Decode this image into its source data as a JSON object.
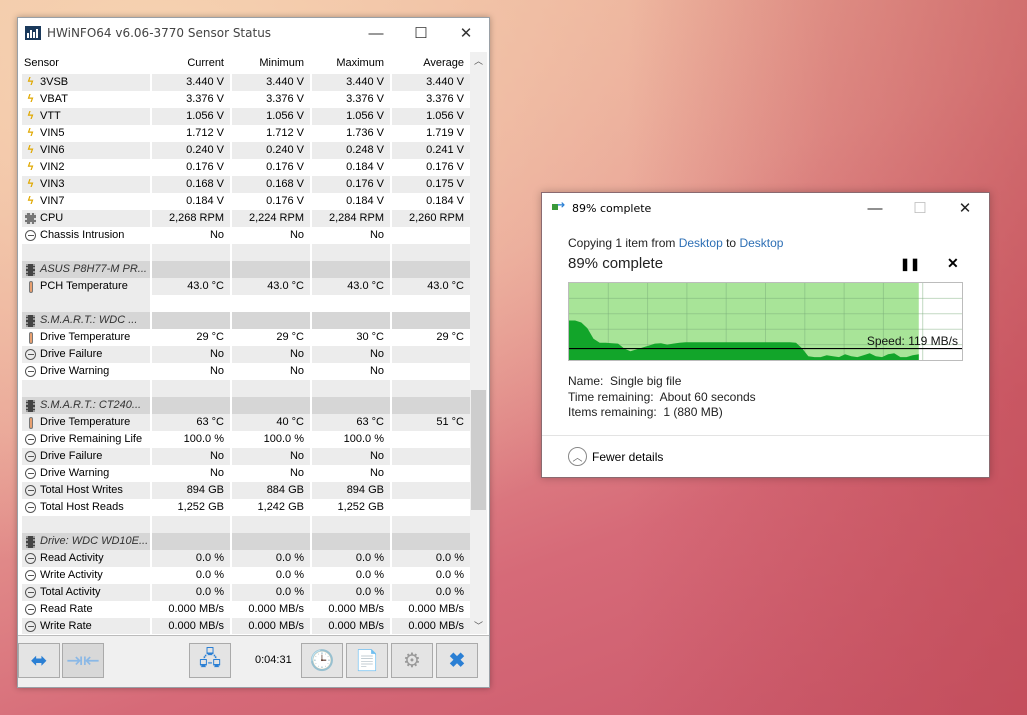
{
  "hwinfo": {
    "title": "HWiNFO64 v6.06-3770 Sensor Status",
    "columns": [
      "Sensor",
      "Current",
      "Minimum",
      "Maximum",
      "Average"
    ],
    "rows": [
      {
        "type": "data",
        "icon": "voltage",
        "name": "3VSB",
        "v": [
          "3.440 V",
          "3.440 V",
          "3.440 V",
          "3.440 V"
        ]
      },
      {
        "type": "data",
        "icon": "voltage",
        "name": "VBAT",
        "v": [
          "3.376 V",
          "3.376 V",
          "3.376 V",
          "3.376 V"
        ]
      },
      {
        "type": "data",
        "icon": "voltage",
        "name": "VTT",
        "v": [
          "1.056 V",
          "1.056 V",
          "1.056 V",
          "1.056 V"
        ]
      },
      {
        "type": "data",
        "icon": "voltage",
        "name": "VIN5",
        "v": [
          "1.712 V",
          "1.712 V",
          "1.736 V",
          "1.719 V"
        ]
      },
      {
        "type": "data",
        "icon": "voltage",
        "name": "VIN6",
        "v": [
          "0.240 V",
          "0.240 V",
          "0.248 V",
          "0.241 V"
        ]
      },
      {
        "type": "data",
        "icon": "voltage",
        "name": "VIN2",
        "v": [
          "0.176 V",
          "0.176 V",
          "0.184 V",
          "0.176 V"
        ]
      },
      {
        "type": "data",
        "icon": "voltage",
        "name": "VIN3",
        "v": [
          "0.168 V",
          "0.168 V",
          "0.176 V",
          "0.175 V"
        ]
      },
      {
        "type": "data",
        "icon": "voltage",
        "name": "VIN7",
        "v": [
          "0.184 V",
          "0.176 V",
          "0.184 V",
          "0.184 V"
        ]
      },
      {
        "type": "data",
        "icon": "fan",
        "name": "CPU",
        "v": [
          "2,268 RPM",
          "2,224 RPM",
          "2,284 RPM",
          "2,260 RPM"
        ]
      },
      {
        "type": "data",
        "icon": "clock",
        "name": "Chassis Intrusion",
        "v": [
          "No",
          "No",
          "No",
          ""
        ]
      },
      {
        "type": "blank"
      },
      {
        "type": "group",
        "icon": "chip",
        "name": "ASUS P8H77-M PR..."
      },
      {
        "type": "data",
        "icon": "thermometer",
        "name": "PCH Temperature",
        "v": [
          "43.0 °C",
          "43.0 °C",
          "43.0 °C",
          "43.0 °C"
        ]
      },
      {
        "type": "blank"
      },
      {
        "type": "group",
        "icon": "chip",
        "name": "S.M.A.R.T.: WDC ..."
      },
      {
        "type": "data",
        "icon": "thermometer",
        "name": "Drive Temperature",
        "v": [
          "29 °C",
          "29 °C",
          "30 °C",
          "29 °C"
        ]
      },
      {
        "type": "data",
        "icon": "clock",
        "name": "Drive Failure",
        "v": [
          "No",
          "No",
          "No",
          ""
        ]
      },
      {
        "type": "data",
        "icon": "clock",
        "name": "Drive Warning",
        "v": [
          "No",
          "No",
          "No",
          ""
        ]
      },
      {
        "type": "blank"
      },
      {
        "type": "group",
        "icon": "chip",
        "name": "S.M.A.R.T.: CT240..."
      },
      {
        "type": "data",
        "icon": "thermometer",
        "name": "Drive Temperature",
        "v": [
          "63 °C",
          "40 °C",
          "63 °C",
          "51 °C"
        ]
      },
      {
        "type": "data",
        "icon": "clock",
        "name": "Drive Remaining Life",
        "v": [
          "100.0 %",
          "100.0 %",
          "100.0 %",
          ""
        ]
      },
      {
        "type": "data",
        "icon": "clock",
        "name": "Drive Failure",
        "v": [
          "No",
          "No",
          "No",
          ""
        ]
      },
      {
        "type": "data",
        "icon": "clock",
        "name": "Drive Warning",
        "v": [
          "No",
          "No",
          "No",
          ""
        ]
      },
      {
        "type": "data",
        "icon": "clock",
        "name": "Total Host Writes",
        "v": [
          "894 GB",
          "884 GB",
          "894 GB",
          ""
        ]
      },
      {
        "type": "data",
        "icon": "clock",
        "name": "Total Host Reads",
        "v": [
          "1,252 GB",
          "1,242 GB",
          "1,252 GB",
          ""
        ]
      },
      {
        "type": "blank"
      },
      {
        "type": "group",
        "icon": "chip",
        "name": "Drive: WDC WD10E..."
      },
      {
        "type": "data",
        "icon": "clock",
        "name": "Read Activity",
        "v": [
          "0.0 %",
          "0.0 %",
          "0.0 %",
          "0.0 %"
        ]
      },
      {
        "type": "data",
        "icon": "clock",
        "name": "Write Activity",
        "v": [
          "0.0 %",
          "0.0 %",
          "0.0 %",
          "0.0 %"
        ]
      },
      {
        "type": "data",
        "icon": "clock",
        "name": "Total Activity",
        "v": [
          "0.0 %",
          "0.0 %",
          "0.0 %",
          "0.0 %"
        ]
      },
      {
        "type": "data",
        "icon": "clock",
        "name": "Read Rate",
        "v": [
          "0.000 MB/s",
          "0.000 MB/s",
          "0.000 MB/s",
          "0.000 MB/s"
        ]
      },
      {
        "type": "data",
        "icon": "clock",
        "name": "Write Rate",
        "v": [
          "0.000 MB/s",
          "0.000 MB/s",
          "0.000 MB/s",
          "0.000 MB/s"
        ]
      }
    ],
    "timer": "0:04:31"
  },
  "copy": {
    "title": "89% complete",
    "copying_prefix": "Copying 1 item from",
    "source": "Desktop",
    "to": "to",
    "dest": "Desktop",
    "progress_label": "89% complete",
    "progress_fraction": 0.89,
    "speed_label": "Speed: 119 MB/s",
    "current_speed": 119,
    "speed_max": 800,
    "speed_history": [
      410,
      410,
      390,
      330,
      220,
      180,
      180,
      175,
      170,
      120,
      90,
      110,
      130,
      150,
      170,
      175,
      160,
      170,
      180,
      185,
      185,
      185,
      185,
      185,
      185,
      185,
      185,
      185,
      185,
      185,
      185,
      185,
      185,
      185,
      185,
      185,
      185,
      180,
      120,
      40,
      30,
      30,
      50,
      40,
      30,
      60,
      40,
      30,
      50,
      70,
      40,
      30,
      60,
      70,
      30,
      30,
      50,
      60
    ],
    "name_label": "Name:",
    "name_value": "Single big file",
    "time_label": "Time remaining:",
    "time_value": "About 60 seconds",
    "items_label": "Items remaining:",
    "items_value": "1 (880 MB)",
    "fewer_details": "Fewer details",
    "colors": {
      "graph_fill": "#a8e498",
      "graph_area": "#12a52a",
      "link": "#2d6fb5"
    }
  }
}
